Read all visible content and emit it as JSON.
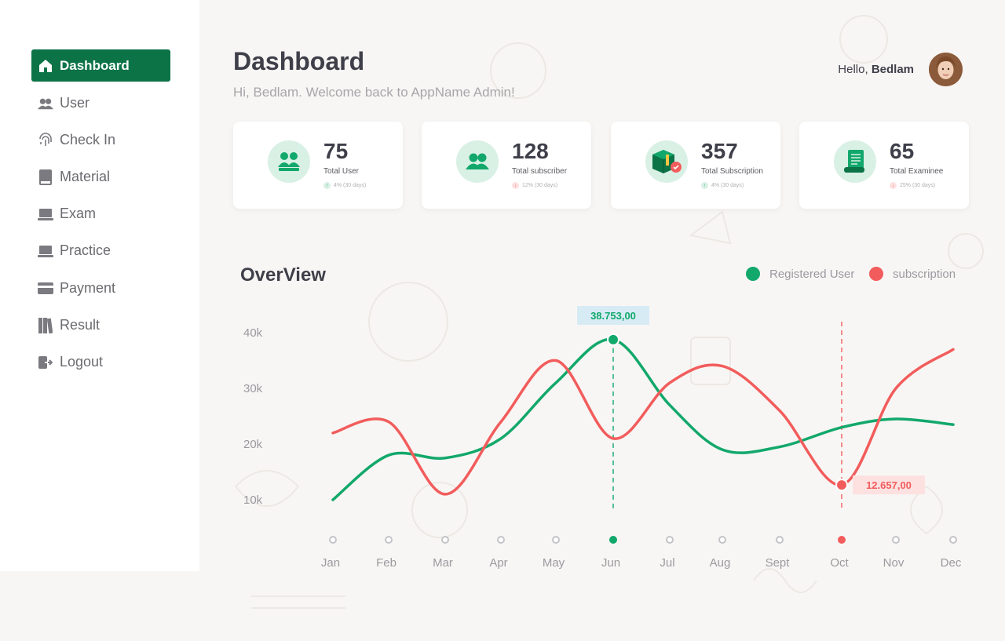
{
  "sidebar": {
    "items": [
      {
        "label": "Dashboard",
        "icon": "home-icon",
        "active": true
      },
      {
        "label": "User",
        "icon": "users-icon"
      },
      {
        "label": "Check In",
        "icon": "fingerprint-icon"
      },
      {
        "label": "Material",
        "icon": "book-icon"
      },
      {
        "label": "Exam",
        "icon": "laptop-icon"
      },
      {
        "label": "Practice",
        "icon": "laptop-icon"
      },
      {
        "label": "Payment",
        "icon": "credit-card-icon"
      },
      {
        "label": "Result",
        "icon": "books-icon"
      },
      {
        "label": "Logout",
        "icon": "logout-icon"
      }
    ]
  },
  "header": {
    "title": "Dashboard",
    "subtitle": "Hi, Bedlam. Welcome back  to AppName Admin!",
    "greeting": "Hello,",
    "username": "Bedlam"
  },
  "cards": [
    {
      "value": "75",
      "label": "Total User",
      "delta": "4% (30 days)",
      "trend": "up",
      "icon": "users-icon"
    },
    {
      "value": "128",
      "label": "Total subscriber",
      "delta": "12% (30 days)",
      "trend": "down",
      "icon": "users-icon"
    },
    {
      "value": "357",
      "label": "Total Subscription",
      "delta": "4% (30 days)",
      "trend": "up",
      "icon": "package-icon"
    },
    {
      "value": "65",
      "label": "Total Examinee",
      "delta": "25% (30 days)",
      "trend": "down",
      "icon": "document-icon"
    }
  ],
  "overview": {
    "title": "OverView",
    "legend": [
      {
        "label": "Registered User",
        "color": "#12a86b"
      },
      {
        "label": "subscription",
        "color": "#f25c5c"
      }
    ]
  },
  "colors": {
    "accent": "#0c7347",
    "green": "#12a86b",
    "red": "#f25c5c"
  },
  "chart_data": {
    "type": "line",
    "x": [
      "Jan",
      "Feb",
      "Mar",
      "Apr",
      "May",
      "Jun",
      "Jul",
      "Aug",
      "Sept",
      "Oct",
      "Nov",
      "Dec"
    ],
    "yticks": [
      "10k",
      "20k",
      "30k",
      "40k"
    ],
    "ylim": [
      10000,
      40000
    ],
    "series": [
      {
        "name": "Registered User",
        "color": "#12a86b",
        "values": [
          10000,
          18000,
          17500,
          21000,
          31000,
          38753,
          27000,
          19000,
          19500,
          23000,
          24500,
          23500
        ]
      },
      {
        "name": "subscription",
        "color": "#f25c5c",
        "values": [
          22000,
          24000,
          11000,
          24000,
          35000,
          21000,
          31000,
          34000,
          26000,
          12657,
          30000,
          37000
        ]
      }
    ],
    "highlights": [
      {
        "series": "Registered User",
        "x": "Jun",
        "label": "38.753,00"
      },
      {
        "series": "subscription",
        "x": "Oct",
        "label": "12.657,00"
      }
    ]
  }
}
